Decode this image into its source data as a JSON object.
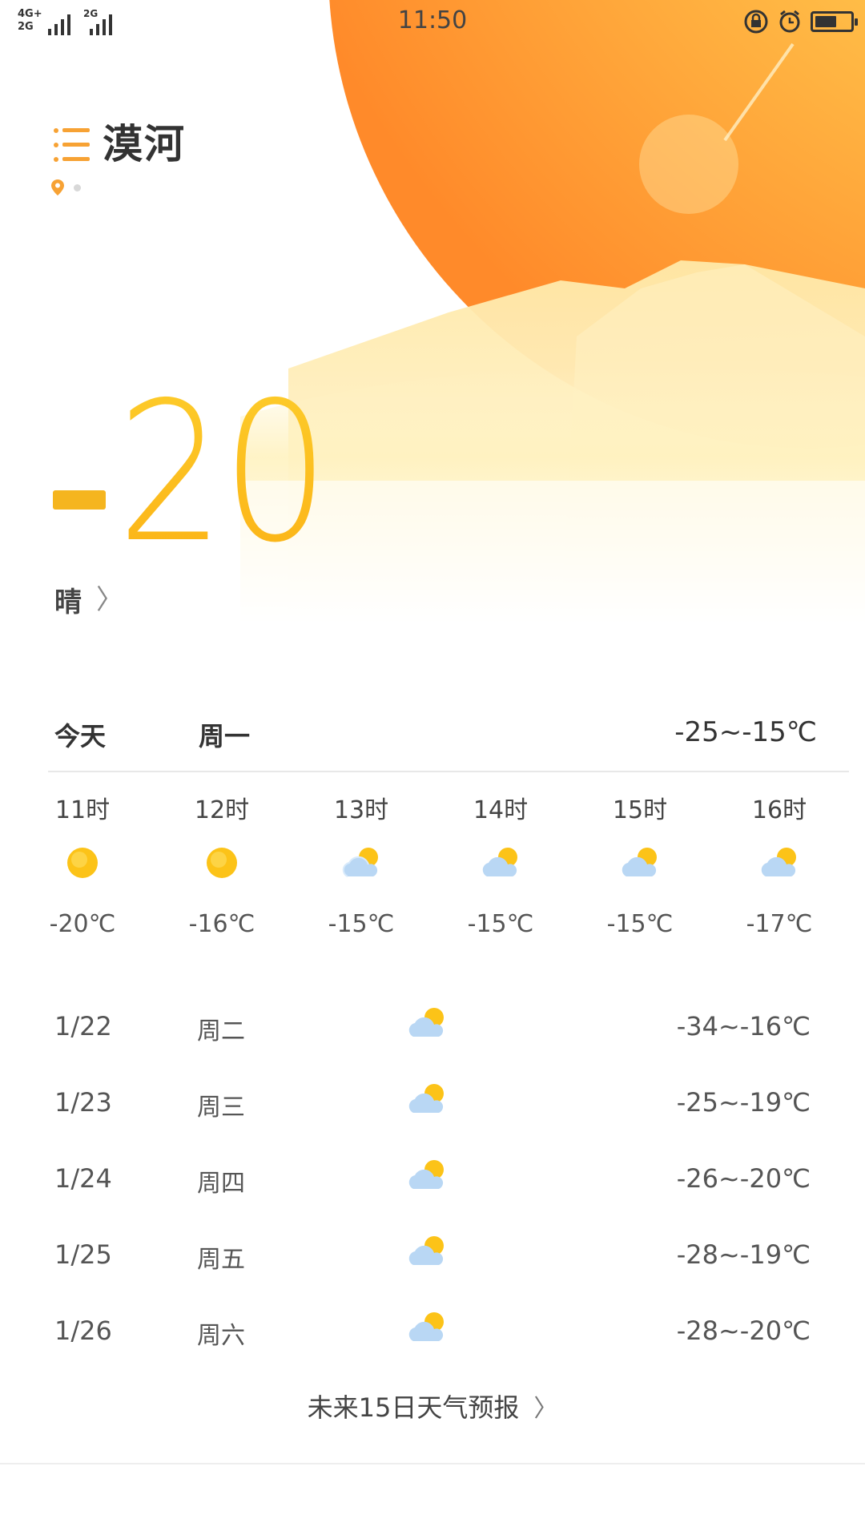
{
  "status_bar": {
    "net_a": "4G+",
    "net_b": "2G",
    "net_c": "2G",
    "time": "11:50",
    "icons": [
      "rotation-lock-icon",
      "alarm-icon",
      "battery-icon"
    ],
    "battery_level": 0.55
  },
  "header": {
    "city": "漠河",
    "menu_icon": "menu-list-icon",
    "page_indicators": [
      "location-pin-icon",
      "dot"
    ]
  },
  "current": {
    "temperature_digits": "20",
    "temperature_sign": "-",
    "condition": "晴"
  },
  "today": {
    "label": "今天",
    "weekday": "周一",
    "range": "-25~-15℃"
  },
  "hourly": [
    {
      "hour": "11时",
      "icon": "sunny",
      "temp": "-20℃"
    },
    {
      "hour": "12时",
      "icon": "sunny",
      "temp": "-16℃"
    },
    {
      "hour": "13时",
      "icon": "partly-cloudy",
      "temp": "-15℃"
    },
    {
      "hour": "14时",
      "icon": "partly-cloudy",
      "temp": "-15℃"
    },
    {
      "hour": "15时",
      "icon": "partly-cloudy",
      "temp": "-15℃"
    },
    {
      "hour": "16时",
      "icon": "partly-cloudy",
      "temp": "-17℃"
    }
  ],
  "daily": [
    {
      "date": "1/22",
      "weekday": "周二",
      "icon": "partly-cloudy",
      "range": "-34~-16℃"
    },
    {
      "date": "1/23",
      "weekday": "周三",
      "icon": "partly-cloudy",
      "range": "-25~-19℃"
    },
    {
      "date": "1/24",
      "weekday": "周四",
      "icon": "partly-cloudy",
      "range": "-26~-20℃"
    },
    {
      "date": "1/25",
      "weekday": "周五",
      "icon": "partly-cloudy",
      "range": "-28~-19℃"
    },
    {
      "date": "1/26",
      "weekday": "周六",
      "icon": "partly-cloudy",
      "range": "-28~-20℃"
    }
  ],
  "forecast_link": {
    "label": "未来15日天气预报",
    "chevron": "〉"
  },
  "colors": {
    "accent": "#fbb316",
    "sun_orange": "#ff8a2a",
    "text_dark": "#333333",
    "divider": "#e8e8e8"
  }
}
